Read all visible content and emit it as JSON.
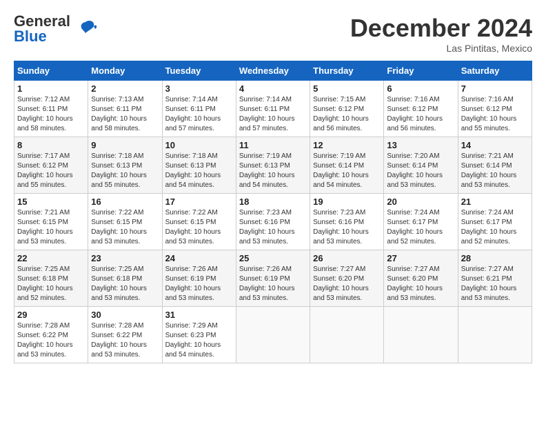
{
  "header": {
    "logo_general": "General",
    "logo_blue": "Blue",
    "month_title": "December 2024",
    "location": "Las Pintitas, Mexico"
  },
  "weekdays": [
    "Sunday",
    "Monday",
    "Tuesday",
    "Wednesday",
    "Thursday",
    "Friday",
    "Saturday"
  ],
  "weeks": [
    [
      {
        "day": "1",
        "lines": [
          "Sunrise: 7:12 AM",
          "Sunset: 6:11 PM",
          "Daylight: 10 hours",
          "and 58 minutes."
        ]
      },
      {
        "day": "2",
        "lines": [
          "Sunrise: 7:13 AM",
          "Sunset: 6:11 PM",
          "Daylight: 10 hours",
          "and 58 minutes."
        ]
      },
      {
        "day": "3",
        "lines": [
          "Sunrise: 7:14 AM",
          "Sunset: 6:11 PM",
          "Daylight: 10 hours",
          "and 57 minutes."
        ]
      },
      {
        "day": "4",
        "lines": [
          "Sunrise: 7:14 AM",
          "Sunset: 6:11 PM",
          "Daylight: 10 hours",
          "and 57 minutes."
        ]
      },
      {
        "day": "5",
        "lines": [
          "Sunrise: 7:15 AM",
          "Sunset: 6:12 PM",
          "Daylight: 10 hours",
          "and 56 minutes."
        ]
      },
      {
        "day": "6",
        "lines": [
          "Sunrise: 7:16 AM",
          "Sunset: 6:12 PM",
          "Daylight: 10 hours",
          "and 56 minutes."
        ]
      },
      {
        "day": "7",
        "lines": [
          "Sunrise: 7:16 AM",
          "Sunset: 6:12 PM",
          "Daylight: 10 hours",
          "and 55 minutes."
        ]
      }
    ],
    [
      {
        "day": "8",
        "lines": [
          "Sunrise: 7:17 AM",
          "Sunset: 6:12 PM",
          "Daylight: 10 hours",
          "and 55 minutes."
        ]
      },
      {
        "day": "9",
        "lines": [
          "Sunrise: 7:18 AM",
          "Sunset: 6:13 PM",
          "Daylight: 10 hours",
          "and 55 minutes."
        ]
      },
      {
        "day": "10",
        "lines": [
          "Sunrise: 7:18 AM",
          "Sunset: 6:13 PM",
          "Daylight: 10 hours",
          "and 54 minutes."
        ]
      },
      {
        "day": "11",
        "lines": [
          "Sunrise: 7:19 AM",
          "Sunset: 6:13 PM",
          "Daylight: 10 hours",
          "and 54 minutes."
        ]
      },
      {
        "day": "12",
        "lines": [
          "Sunrise: 7:19 AM",
          "Sunset: 6:14 PM",
          "Daylight: 10 hours",
          "and 54 minutes."
        ]
      },
      {
        "day": "13",
        "lines": [
          "Sunrise: 7:20 AM",
          "Sunset: 6:14 PM",
          "Daylight: 10 hours",
          "and 53 minutes."
        ]
      },
      {
        "day": "14",
        "lines": [
          "Sunrise: 7:21 AM",
          "Sunset: 6:14 PM",
          "Daylight: 10 hours",
          "and 53 minutes."
        ]
      }
    ],
    [
      {
        "day": "15",
        "lines": [
          "Sunrise: 7:21 AM",
          "Sunset: 6:15 PM",
          "Daylight: 10 hours",
          "and 53 minutes."
        ]
      },
      {
        "day": "16",
        "lines": [
          "Sunrise: 7:22 AM",
          "Sunset: 6:15 PM",
          "Daylight: 10 hours",
          "and 53 minutes."
        ]
      },
      {
        "day": "17",
        "lines": [
          "Sunrise: 7:22 AM",
          "Sunset: 6:15 PM",
          "Daylight: 10 hours",
          "and 53 minutes."
        ]
      },
      {
        "day": "18",
        "lines": [
          "Sunrise: 7:23 AM",
          "Sunset: 6:16 PM",
          "Daylight: 10 hours",
          "and 53 minutes."
        ]
      },
      {
        "day": "19",
        "lines": [
          "Sunrise: 7:23 AM",
          "Sunset: 6:16 PM",
          "Daylight: 10 hours",
          "and 53 minutes."
        ]
      },
      {
        "day": "20",
        "lines": [
          "Sunrise: 7:24 AM",
          "Sunset: 6:17 PM",
          "Daylight: 10 hours",
          "and 52 minutes."
        ]
      },
      {
        "day": "21",
        "lines": [
          "Sunrise: 7:24 AM",
          "Sunset: 6:17 PM",
          "Daylight: 10 hours",
          "and 52 minutes."
        ]
      }
    ],
    [
      {
        "day": "22",
        "lines": [
          "Sunrise: 7:25 AM",
          "Sunset: 6:18 PM",
          "Daylight: 10 hours",
          "and 52 minutes."
        ]
      },
      {
        "day": "23",
        "lines": [
          "Sunrise: 7:25 AM",
          "Sunset: 6:18 PM",
          "Daylight: 10 hours",
          "and 53 minutes."
        ]
      },
      {
        "day": "24",
        "lines": [
          "Sunrise: 7:26 AM",
          "Sunset: 6:19 PM",
          "Daylight: 10 hours",
          "and 53 minutes."
        ]
      },
      {
        "day": "25",
        "lines": [
          "Sunrise: 7:26 AM",
          "Sunset: 6:19 PM",
          "Daylight: 10 hours",
          "and 53 minutes."
        ]
      },
      {
        "day": "26",
        "lines": [
          "Sunrise: 7:27 AM",
          "Sunset: 6:20 PM",
          "Daylight: 10 hours",
          "and 53 minutes."
        ]
      },
      {
        "day": "27",
        "lines": [
          "Sunrise: 7:27 AM",
          "Sunset: 6:20 PM",
          "Daylight: 10 hours",
          "and 53 minutes."
        ]
      },
      {
        "day": "28",
        "lines": [
          "Sunrise: 7:27 AM",
          "Sunset: 6:21 PM",
          "Daylight: 10 hours",
          "and 53 minutes."
        ]
      }
    ],
    [
      {
        "day": "29",
        "lines": [
          "Sunrise: 7:28 AM",
          "Sunset: 6:22 PM",
          "Daylight: 10 hours",
          "and 53 minutes."
        ]
      },
      {
        "day": "30",
        "lines": [
          "Sunrise: 7:28 AM",
          "Sunset: 6:22 PM",
          "Daylight: 10 hours",
          "and 53 minutes."
        ]
      },
      {
        "day": "31",
        "lines": [
          "Sunrise: 7:29 AM",
          "Sunset: 6:23 PM",
          "Daylight: 10 hours",
          "and 54 minutes."
        ]
      },
      {
        "day": "",
        "lines": []
      },
      {
        "day": "",
        "lines": []
      },
      {
        "day": "",
        "lines": []
      },
      {
        "day": "",
        "lines": []
      }
    ]
  ]
}
